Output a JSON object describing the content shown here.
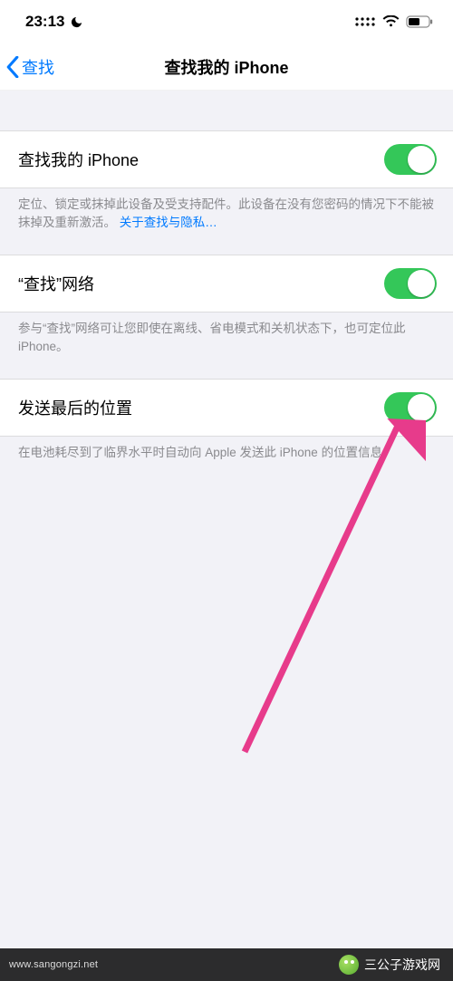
{
  "status": {
    "time": "23:13"
  },
  "nav": {
    "back_label": "查找",
    "title": "查找我的 iPhone"
  },
  "rows": {
    "find_iphone": {
      "label": "查找我的 iPhone",
      "on": true
    },
    "find_network": {
      "label": "“查找”网络",
      "on": true
    },
    "send_last": {
      "label": "发送最后的位置",
      "on": true
    }
  },
  "footers": {
    "find_iphone_text": "定位、锁定或抹掉此设备及受支持配件。此设备在没有您密码的情况下不能被抹掉及重新激活。",
    "find_iphone_link": "关于查找与隐私…",
    "find_network_text": "参与“查找”网络可让您即使在离线、省电模式和关机状态下，也可定位此 iPhone。",
    "send_last_text": "在电池耗尽到了临界水平时自动向 Apple 发送此 iPhone 的位置信息。"
  },
  "watermark": {
    "url": "www.sangongzi.net",
    "brand": "三公子游戏网"
  }
}
